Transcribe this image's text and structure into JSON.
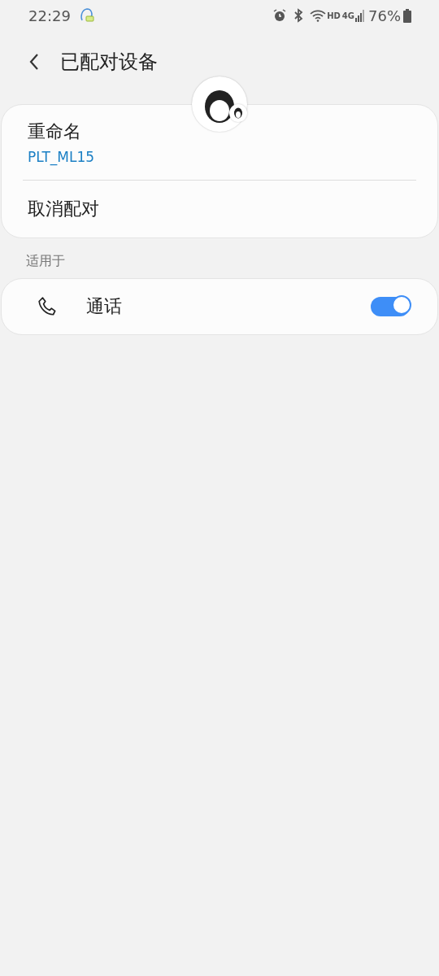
{
  "status_bar": {
    "time": "22:29",
    "network_badge": "HD",
    "network_type": "4G",
    "battery": "76%"
  },
  "header": {
    "title": "已配对设备"
  },
  "device_card": {
    "rename_label": "重命名",
    "device_name": "PLT_ML15",
    "unpair_label": "取消配对"
  },
  "section": {
    "title": "适用于"
  },
  "profiles": [
    {
      "label": "通话",
      "on": true
    }
  ]
}
